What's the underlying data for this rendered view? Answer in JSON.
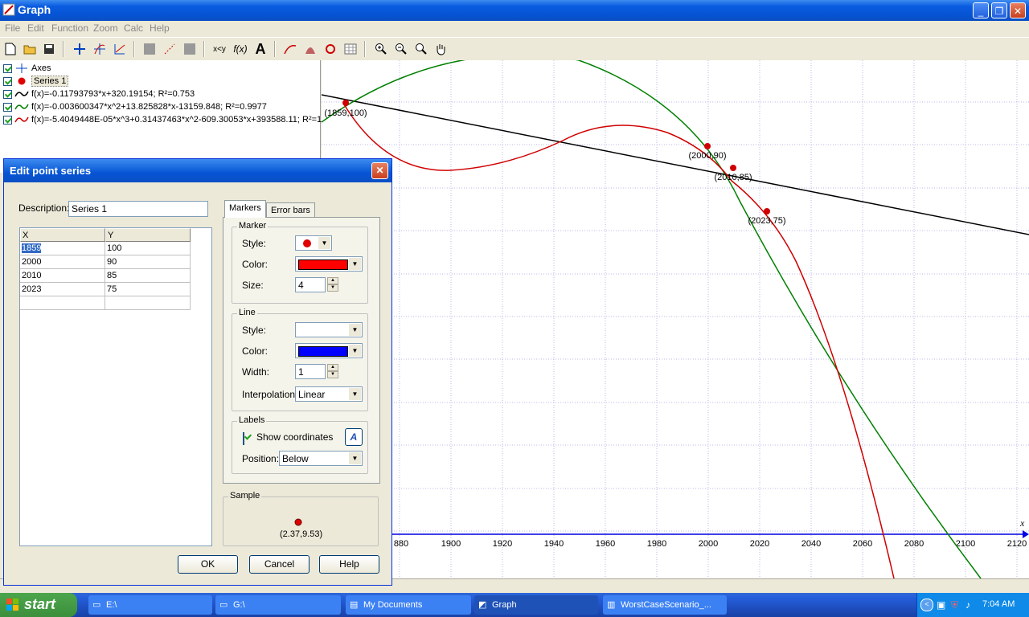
{
  "window": {
    "title": "Graph"
  },
  "menu": [
    "File",
    "Edit",
    "Function",
    "Zoom",
    "Calc",
    "Help"
  ],
  "function_list": [
    {
      "label": "Axes"
    },
    {
      "label": "Series 1"
    },
    {
      "label": "f(x)=-0.11793793*x+320.19154; R²=0.753"
    },
    {
      "label": "f(x)=-0.003600347*x^2+13.825828*x-13159.848; R²=0.9977"
    },
    {
      "label": "f(x)=-5.4049448E-05*x^3+0.31437463*x^2-609.30053*x+393588.11; R²=1"
    }
  ],
  "graph": {
    "x_axis_label": "x",
    "x_ticks": [
      "880",
      "1900",
      "1920",
      "1940",
      "1960",
      "1980",
      "2000",
      "2020",
      "2040",
      "2060",
      "2080",
      "2100",
      "2120"
    ],
    "points": [
      {
        "label": "(1859,100)"
      },
      {
        "label": "(2000,90)"
      },
      {
        "label": "(2010,85)"
      },
      {
        "label": "(2023,75)"
      }
    ]
  },
  "dialog": {
    "title": "Edit point series",
    "description_label": "Description:",
    "description_value": "Series 1",
    "columns": [
      "X",
      "Y"
    ],
    "rows": [
      [
        "1859",
        "100"
      ],
      [
        "2000",
        "90"
      ],
      [
        "2010",
        "85"
      ],
      [
        "2023",
        "75"
      ]
    ],
    "tabs": [
      "Markers",
      "Error bars"
    ],
    "marker": {
      "group": "Marker",
      "style_label": "Style:",
      "color_label": "Color:",
      "size_label": "Size:",
      "size_value": "4",
      "color": "#ff0000"
    },
    "line": {
      "group": "Line",
      "style_label": "Style:",
      "color_label": "Color:",
      "width_label": "Width:",
      "width_value": "1",
      "interp_label": "Interpolation:",
      "interp_value": "Linear",
      "color": "#0000ff"
    },
    "labels": {
      "group": "Labels",
      "show_coords": "Show coordinates",
      "position_label": "Position:",
      "position_value": "Below"
    },
    "sample": {
      "group": "Sample",
      "coords": "(2.37,9.53)"
    },
    "buttons": {
      "ok": "OK",
      "cancel": "Cancel",
      "help": "Help"
    }
  },
  "taskbar": {
    "start": "start",
    "tasks": [
      "E:\\",
      "G:\\",
      "My Documents",
      "Graph",
      "WorstCaseScenario_..."
    ],
    "clock": "7:04 AM"
  }
}
